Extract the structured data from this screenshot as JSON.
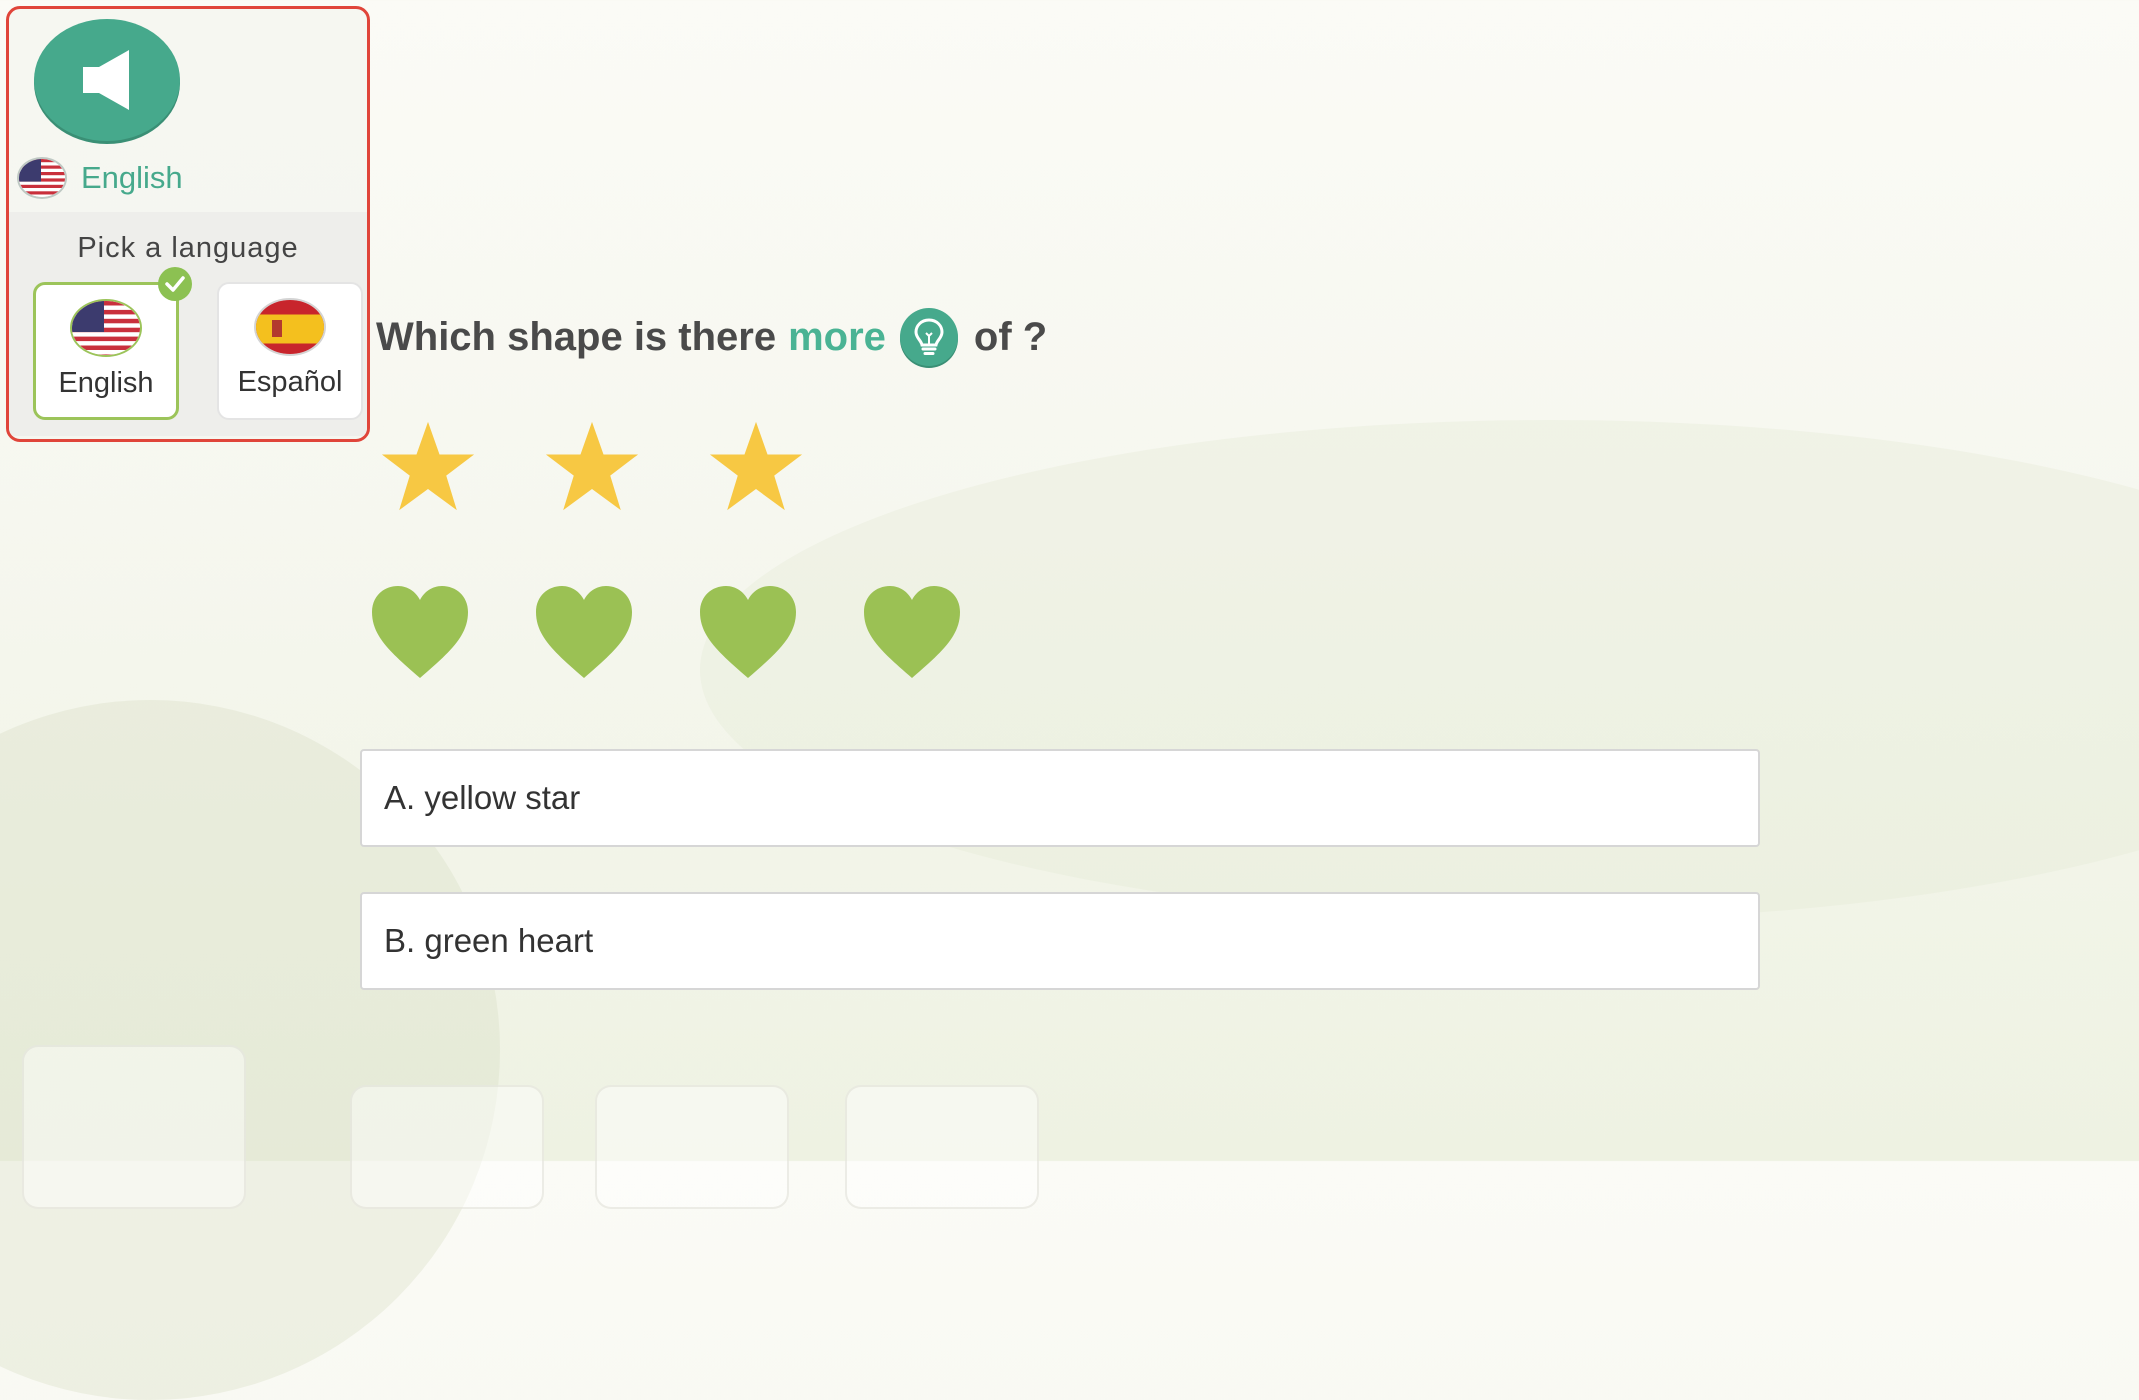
{
  "language_panel": {
    "current_language": "English",
    "picker_title": "Pick a language",
    "options": [
      {
        "label": "English",
        "selected": true
      },
      {
        "label": "Español",
        "selected": false
      }
    ]
  },
  "question": {
    "text_before": "Which shape is there",
    "highlight": "more",
    "text_after": "of ?",
    "shapes": [
      {
        "name": "yellow star",
        "count": 3,
        "color": "#f7c843"
      },
      {
        "name": "green heart",
        "count": 4,
        "color": "#9bc154"
      }
    ]
  },
  "answers": [
    {
      "label": "A. yellow star"
    },
    {
      "label": "B. green heart"
    }
  ],
  "colors": {
    "accent": "#46a98c",
    "highlight": "#e0453a",
    "check": "#8cc152"
  }
}
